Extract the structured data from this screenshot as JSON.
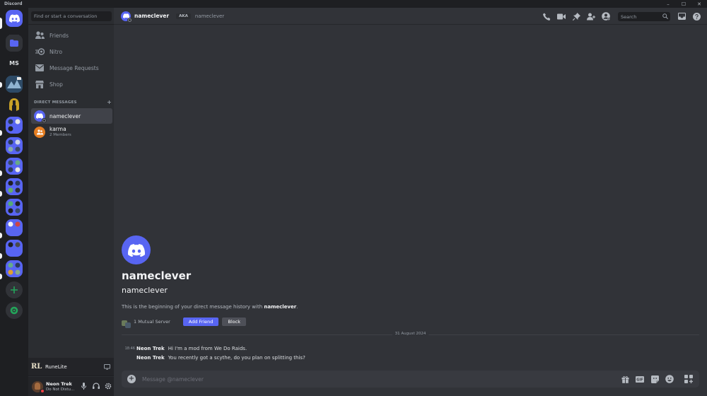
{
  "window": {
    "title": "Discord",
    "controls": [
      "–",
      "☐",
      "✕"
    ]
  },
  "rail": {
    "servers": [
      {
        "label": "MS"
      }
    ]
  },
  "sidebar": {
    "search_placeholder": "Find or start a conversation",
    "nav": [
      {
        "label": "Friends",
        "icon": "friends-icon"
      },
      {
        "label": "Nitro",
        "icon": "nitro-icon"
      },
      {
        "label": "Message Requests",
        "icon": "mail-icon"
      },
      {
        "label": "Shop",
        "icon": "shop-icon"
      }
    ],
    "dm_header": "DIRECT MESSAGES",
    "dm_add": "+",
    "dms": [
      {
        "name": "nameclever",
        "sub": ""
      },
      {
        "name": "karma",
        "sub": "2 Members"
      }
    ]
  },
  "game": {
    "logo": "RL",
    "name": "RuneLite"
  },
  "user": {
    "name": "Neon Trek",
    "status": "Do Not Distu..."
  },
  "topbar": {
    "name": "nameclever",
    "aka": "AKA",
    "aka_name": "nameclever",
    "search_placeholder": "Search"
  },
  "intro": {
    "name": "nameclever",
    "username": "nameclever",
    "desc_prefix": "This is the beginning of your direct message history with ",
    "desc_name": "nameclever",
    "desc_suffix": ".",
    "mutual": "1 Mutual Server",
    "add_friend": "Add Friend",
    "block": "Block"
  },
  "date_divider": "31 August 2024",
  "messages": [
    {
      "time": "18:46",
      "author": "Neon Trek",
      "text": "Hi I'm a mod from We Do Raids."
    },
    {
      "time": "",
      "author": "Neon Trek",
      "text": "You recently got a scythe, do you plan on splitting this?"
    }
  ],
  "composer": {
    "placeholder": "Message @nameclever"
  },
  "colors": {
    "blurple": "#5865f2",
    "green": "#23a55a",
    "dnd": "#f23f43",
    "orange": "#e67e22"
  }
}
